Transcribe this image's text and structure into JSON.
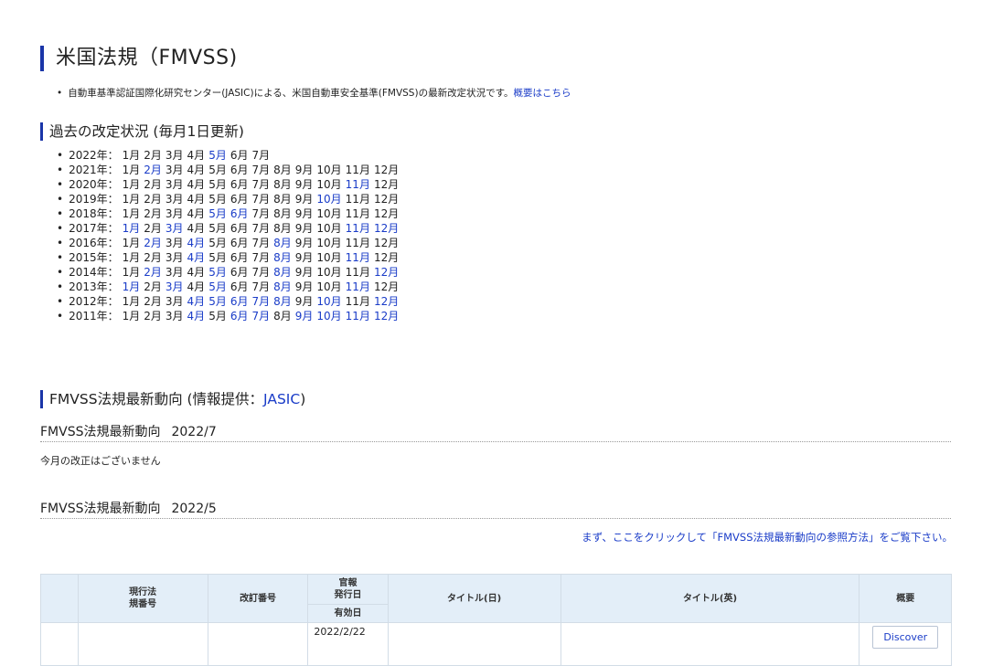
{
  "header": {
    "title": "米国法規（FMVSS)",
    "intro_text": "自動車基準認証国際化研究センター(JASIC)による、米国自動車安全基準(FMVSS)の最新改定状況です。",
    "intro_link": "概要はこちら"
  },
  "history": {
    "heading": "過去の改定状況 (毎月1日更新)",
    "rows": [
      {
        "year": "2022年：",
        "months": [
          "1月",
          "2月",
          "3月",
          "4月",
          "5月",
          "6月",
          "7月"
        ],
        "links": [
          4
        ]
      },
      {
        "year": "2021年：",
        "months": [
          "1月",
          "2月",
          "3月",
          "4月",
          "5月",
          "6月",
          "7月",
          "8月",
          "9月",
          "10月",
          "11月",
          "12月"
        ],
        "links": [
          1
        ]
      },
      {
        "year": "2020年：",
        "months": [
          "1月",
          "2月",
          "3月",
          "4月",
          "5月",
          "6月",
          "7月",
          "8月",
          "9月",
          "10月",
          "11月",
          "12月"
        ],
        "links": [
          10
        ]
      },
      {
        "year": "2019年：",
        "months": [
          "1月",
          "2月",
          "3月",
          "4月",
          "5月",
          "6月",
          "7月",
          "8月",
          "9月",
          "10月",
          "11月",
          "12月"
        ],
        "links": [
          9
        ]
      },
      {
        "year": "2018年：",
        "months": [
          "1月",
          "2月",
          "3月",
          "4月",
          "5月",
          "6月",
          "7月",
          "8月",
          "9月",
          "10月",
          "11月",
          "12月"
        ],
        "links": [
          4,
          5
        ]
      },
      {
        "year": "2017年：",
        "months": [
          "1月",
          "2月",
          "3月",
          "4月",
          "5月",
          "6月",
          "7月",
          "8月",
          "9月",
          "10月",
          "11月",
          "12月"
        ],
        "links": [
          0,
          2,
          10,
          11
        ]
      },
      {
        "year": "2016年：",
        "months": [
          "1月",
          "2月",
          "3月",
          "4月",
          "5月",
          "6月",
          "7月",
          "8月",
          "9月",
          "10月",
          "11月",
          "12月"
        ],
        "links": [
          1,
          3,
          7
        ]
      },
      {
        "year": "2015年：",
        "months": [
          "1月",
          "2月",
          "3月",
          "4月",
          "5月",
          "6月",
          "7月",
          "8月",
          "9月",
          "10月",
          "11月",
          "12月"
        ],
        "links": [
          3,
          7,
          10
        ]
      },
      {
        "year": "2014年：",
        "months": [
          "1月",
          "2月",
          "3月",
          "4月",
          "5月",
          "6月",
          "7月",
          "8月",
          "9月",
          "10月",
          "11月",
          "12月"
        ],
        "links": [
          1,
          4,
          7,
          11
        ]
      },
      {
        "year": "2013年：",
        "months": [
          "1月",
          "2月",
          "3月",
          "4月",
          "5月",
          "6月",
          "7月",
          "8月",
          "9月",
          "10月",
          "11月",
          "12月"
        ],
        "links": [
          0,
          2,
          4,
          7,
          10
        ]
      },
      {
        "year": "2012年：",
        "months": [
          "1月",
          "2月",
          "3月",
          "4月",
          "5月",
          "6月",
          "7月",
          "8月",
          "9月",
          "10月",
          "11月",
          "12月"
        ],
        "links": [
          3,
          4,
          5,
          6,
          7,
          9,
          11
        ]
      },
      {
        "year": "2011年：",
        "months": [
          "1月",
          "2月",
          "3月",
          "4月",
          "5月",
          "6月",
          "7月",
          "8月",
          "9月",
          "10月",
          "11月",
          "12月"
        ],
        "links": [
          3,
          5,
          6,
          8,
          9,
          10,
          11
        ]
      }
    ]
  },
  "latest": {
    "heading_prefix": "FMVSS法規最新動向 (情報提供：",
    "heading_link": "JASIC",
    "heading_suffix": ")",
    "section1": {
      "label": "FMVSS法規最新動向",
      "date": "2022/7",
      "note": "今月の改正はございません"
    },
    "section2": {
      "label": "FMVSS法規最新動向",
      "date": "2022/5"
    },
    "reference_link": "まず、ここをクリックして「FMVSS法規最新動向の参照方法」をご覧下さい。"
  },
  "table": {
    "headers": {
      "current_reg_line1": "現行法",
      "current_reg_line2": "規番号",
      "revision_no": "改訂番号",
      "gazette_line1": "官報",
      "gazette_line2": "発行日",
      "effective_date": "有効日",
      "title_ja": "タイトル(日)",
      "title_en": "タイトル(英)",
      "summary": "概要"
    },
    "rows": [
      {
        "current_reg": "",
        "revision_no": "",
        "issue_date": "2022/2/22",
        "title_ja": "",
        "title_en": "",
        "summary_button": "Discover"
      }
    ]
  }
}
